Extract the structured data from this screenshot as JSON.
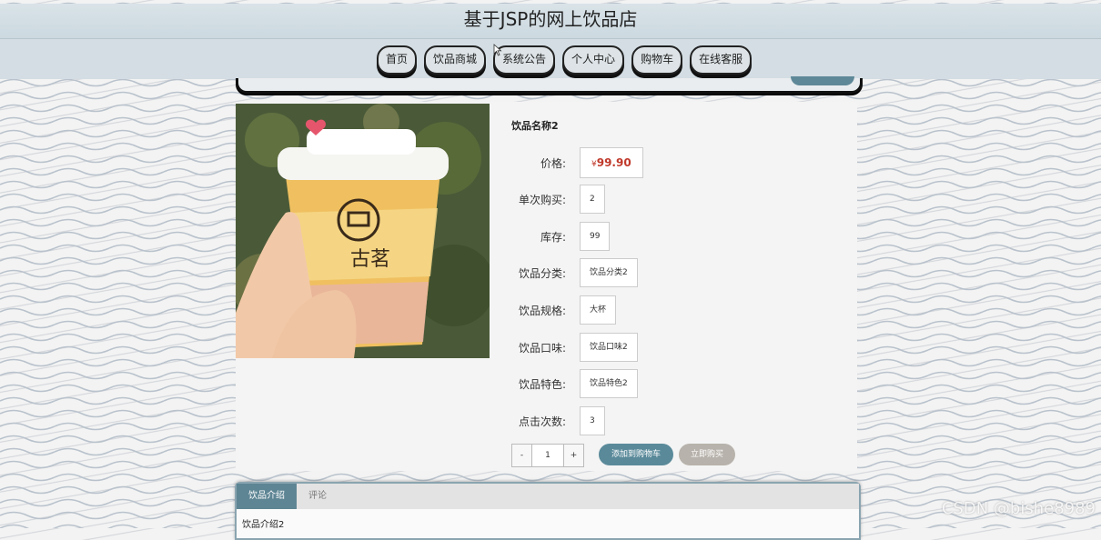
{
  "site": {
    "title": "基于JSP的网上饮品店"
  },
  "nav": {
    "items": [
      {
        "label": "首页"
      },
      {
        "label": "饮品商城"
      },
      {
        "label": "系统公告"
      },
      {
        "label": "个人中心"
      },
      {
        "label": "购物车"
      },
      {
        "label": "在线客服"
      }
    ]
  },
  "product": {
    "name": "饮品名称2",
    "price_label": "价格:",
    "currency": "¥",
    "price": "99.90",
    "fields": [
      {
        "label": "单次购买:",
        "value": "2"
      },
      {
        "label": "库存:",
        "value": "99"
      },
      {
        "label": "饮品分类:",
        "value": "饮品分类2"
      },
      {
        "label": "饮品规格:",
        "value": "大杯"
      },
      {
        "label": "饮品口味:",
        "value": "饮品口味2"
      },
      {
        "label": "饮品特色:",
        "value": "饮品特色2"
      },
      {
        "label": "点击次数:",
        "value": "3"
      }
    ],
    "image_logo_text": "古茗"
  },
  "quantity": {
    "minus": "-",
    "value": "1",
    "plus": "+"
  },
  "actions": {
    "add_to_cart": "添加到购物车",
    "buy_now": "立即购买"
  },
  "tabs": {
    "items": [
      {
        "label": "饮品介绍"
      },
      {
        "label": "评论"
      }
    ],
    "content": "饮品介绍2"
  },
  "watermark": "CSDN @bishe8989",
  "colors": {
    "accent": "#5a8a9a",
    "price": "#c0392b",
    "buy_button": "#b7b2ab"
  }
}
